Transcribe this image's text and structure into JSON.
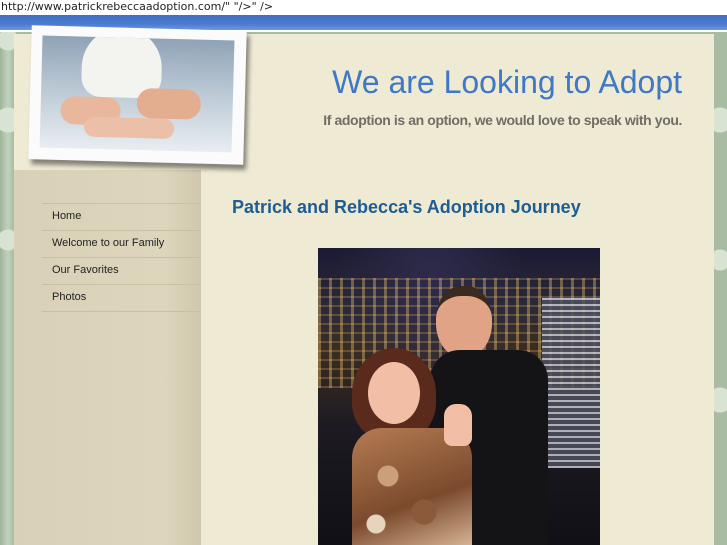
{
  "browser": {
    "url_text": "http://www.patrickrebeccaadoption.com/\" \"/>\" />"
  },
  "header": {
    "title": "We are Looking to Adopt",
    "subtitle": "If adoption is an option, we would love to speak with you.",
    "photo_icon": "baby-feet-photo"
  },
  "nav": {
    "items": [
      {
        "label": "Home"
      },
      {
        "label": "Welcome to our Family"
      },
      {
        "label": "Our Favorites"
      },
      {
        "label": "Photos"
      }
    ]
  },
  "main": {
    "heading": "Patrick and Rebecca's Adoption Journey",
    "photo_icon": "couple-photo"
  },
  "colors": {
    "title_blue": "#3f78c6",
    "heading_blue": "#1e5d92",
    "band_blue": "#4a7bd0",
    "page_bg": "#efead4",
    "sidebar_bg": "#d8d1b7"
  }
}
